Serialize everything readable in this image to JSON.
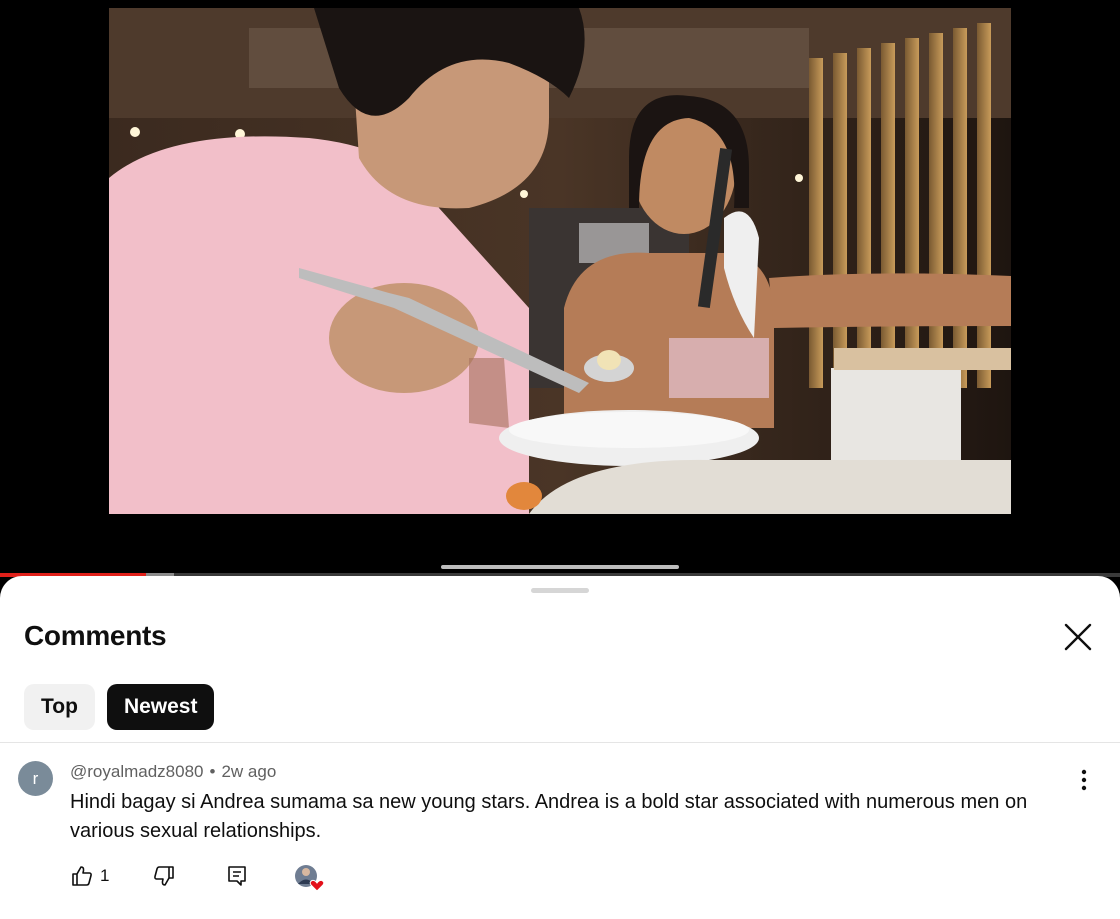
{
  "player": {
    "progress_played_fraction": 0.13,
    "progress_buffered_fraction": 0.155,
    "colors": {
      "played": "#e0201a",
      "buffered": "#8a8a8a"
    }
  },
  "comments_panel": {
    "title": "Comments",
    "close_icon": "close-icon",
    "sort_chips": [
      {
        "label": "Top",
        "selected": false
      },
      {
        "label": "Newest",
        "selected": true
      }
    ]
  },
  "comment": {
    "avatar_letter": "r",
    "author": "@royalmadz8080",
    "separator": "•",
    "time": "2w ago",
    "text": "Hindi bagay si Andrea sumama sa new young stars. Andrea is a bold star associated with numerous men on various sexual relationships.",
    "like_count": "1",
    "icons": {
      "like": "thumbs-up-icon",
      "dislike": "thumbs-down-icon",
      "reply": "reply-icon",
      "creator_heart": "creator-heart-icon",
      "more": "more-vert-icon"
    }
  }
}
